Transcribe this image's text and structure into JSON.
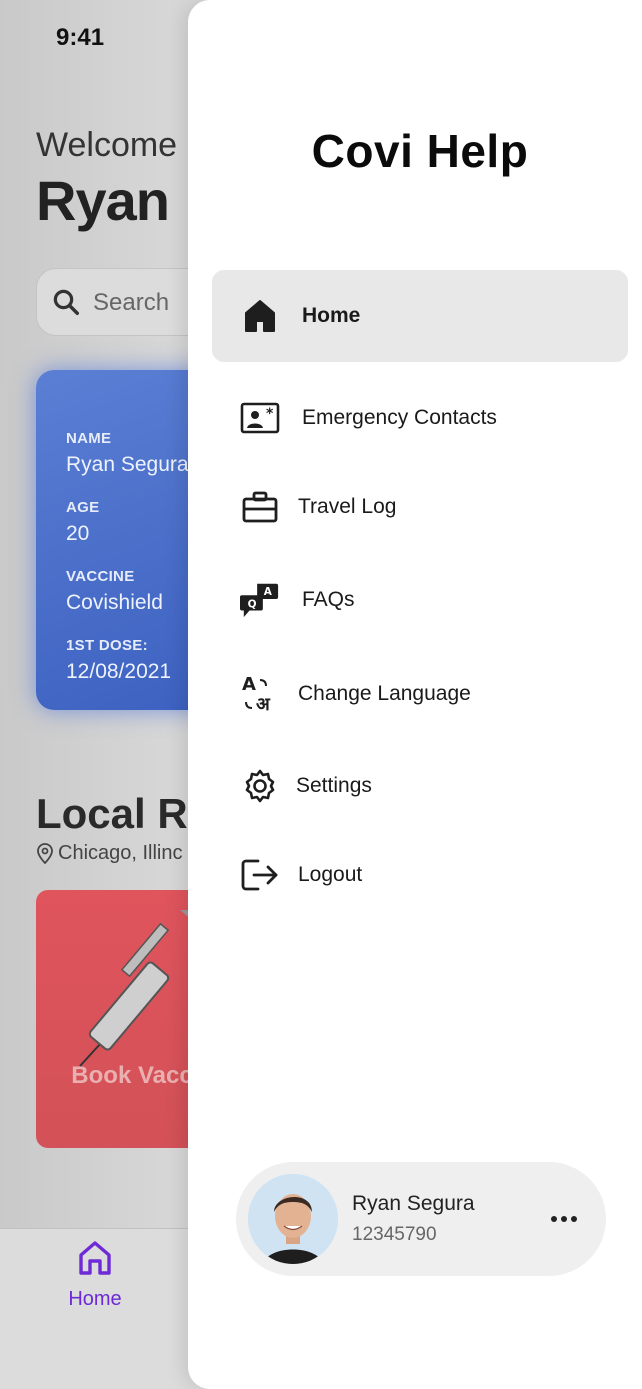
{
  "status_bar": {
    "time": "9:41"
  },
  "home": {
    "welcome": "Welcome",
    "user_name": "Ryan",
    "search_placeholder": "Search",
    "id_card": {
      "name_label": "NAME",
      "name_value": "Ryan Segura",
      "age_label": "AGE",
      "age_value": "20",
      "vaccine_label": "VACCINE",
      "vaccine_value": "Covishield",
      "dose_label": "1ST DOSE:",
      "dose_value": "12/08/2021"
    },
    "local_section_title": "Local Re",
    "location": "Chicago, Illinc",
    "book_card_label": "Book Vaccinatio",
    "bottom_nav": {
      "home_label": "Home",
      "accent": "#6d2ad6"
    }
  },
  "drawer": {
    "title": "Covi Help",
    "menu": [
      {
        "label": "Home",
        "icon": "home-icon",
        "active": true
      },
      {
        "label": "Emergency Contacts",
        "icon": "contact-card-icon",
        "active": false
      },
      {
        "label": "Travel Log",
        "icon": "briefcase-icon",
        "active": false
      },
      {
        "label": "FAQs",
        "icon": "qa-chat-icon",
        "active": false
      },
      {
        "label": "Change Language",
        "icon": "translate-icon",
        "active": false
      },
      {
        "label": "Settings",
        "icon": "gear-icon",
        "active": false
      },
      {
        "label": "Logout",
        "icon": "logout-icon",
        "active": false
      }
    ],
    "profile": {
      "name": "Ryan Segura",
      "id": "12345790"
    }
  }
}
